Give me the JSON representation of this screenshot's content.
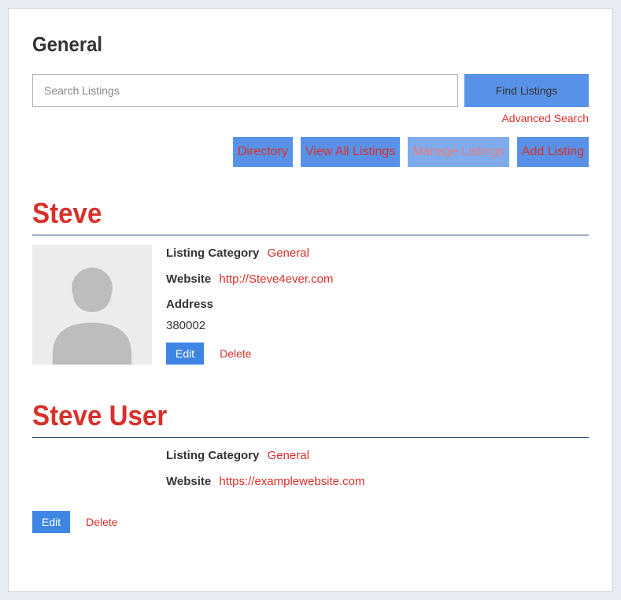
{
  "page": {
    "title": "General"
  },
  "search": {
    "placeholder": "Search Listings",
    "find_label": "Find Listings",
    "advanced_label": "Advanced Search"
  },
  "nav": {
    "directory": "Directory",
    "view_all": "View All Listings",
    "manage": "Manage Listings",
    "add": "Add Listing"
  },
  "labels": {
    "category": "Listing Category",
    "website": "Website",
    "address": "Address",
    "edit": "Edit",
    "delete": "Delete"
  },
  "listings": [
    {
      "name": "Steve",
      "category": "General",
      "website": "http://Steve4ever.com",
      "address": "380002",
      "has_avatar": true
    },
    {
      "name": "Steve User",
      "category": "General",
      "website": "https://examplewebsite.com",
      "address": "",
      "has_avatar": false
    }
  ]
}
